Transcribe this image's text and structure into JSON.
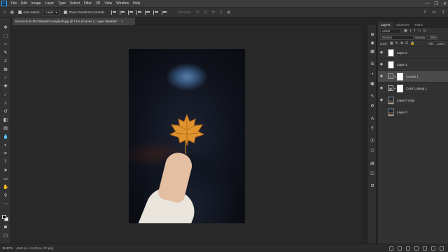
{
  "app": {
    "logo": "Ps",
    "menus": [
      "File",
      "Edit",
      "Image",
      "Layer",
      "Type",
      "Select",
      "Filter",
      "3D",
      "View",
      "Window",
      "Help"
    ],
    "window_controls": [
      "—",
      "❐",
      "✕"
    ]
  },
  "options_bar": {
    "auto_select_label": "Auto-Select",
    "auto_select_target": "Layer",
    "show_transform_label": "Show Transform Controls",
    "mode_3d_label": "3D Mode:"
  },
  "document": {
    "tab_title": "tiard-schulz-ZbrY8jVyWY-unsplash.jpg @ 12% (Curves 1, Layer Mask/8) *",
    "close_glyph": "×"
  },
  "status": {
    "zoom": "11.97%",
    "info": "4160 px x 6240 px (72 ppi)"
  },
  "layers_panel": {
    "tabs": [
      "Layers",
      "Channels",
      "Paths"
    ],
    "filter_kind": "Kind",
    "blend_mode": "Normal",
    "opacity_label": "Opacity:",
    "opacity_value": "100%",
    "lock_label": "Lock:",
    "fill_label": "Fill:",
    "fill_value": "100%",
    "layers": [
      {
        "name": "Layer 2",
        "type": "pixel-white",
        "visible": true,
        "selected": false
      },
      {
        "name": "Layer 1",
        "type": "pixel-white",
        "visible": true,
        "selected": false
      },
      {
        "name": "Curves 1",
        "type": "adjustment-curves",
        "visible": true,
        "selected": true
      },
      {
        "name": "Color Lookup 1",
        "type": "adjustment-lookup",
        "visible": true,
        "selected": false
      },
      {
        "name": "Layer 0 copy",
        "type": "photo",
        "visible": true,
        "selected": false
      },
      {
        "name": "Layer 0",
        "type": "photo",
        "visible": false,
        "selected": false
      }
    ]
  },
  "colors": {
    "accent": "#31a8ff",
    "panel_bg": "#323232",
    "canvas_bg": "#282828",
    "selected_layer": "#4a4a4a"
  }
}
